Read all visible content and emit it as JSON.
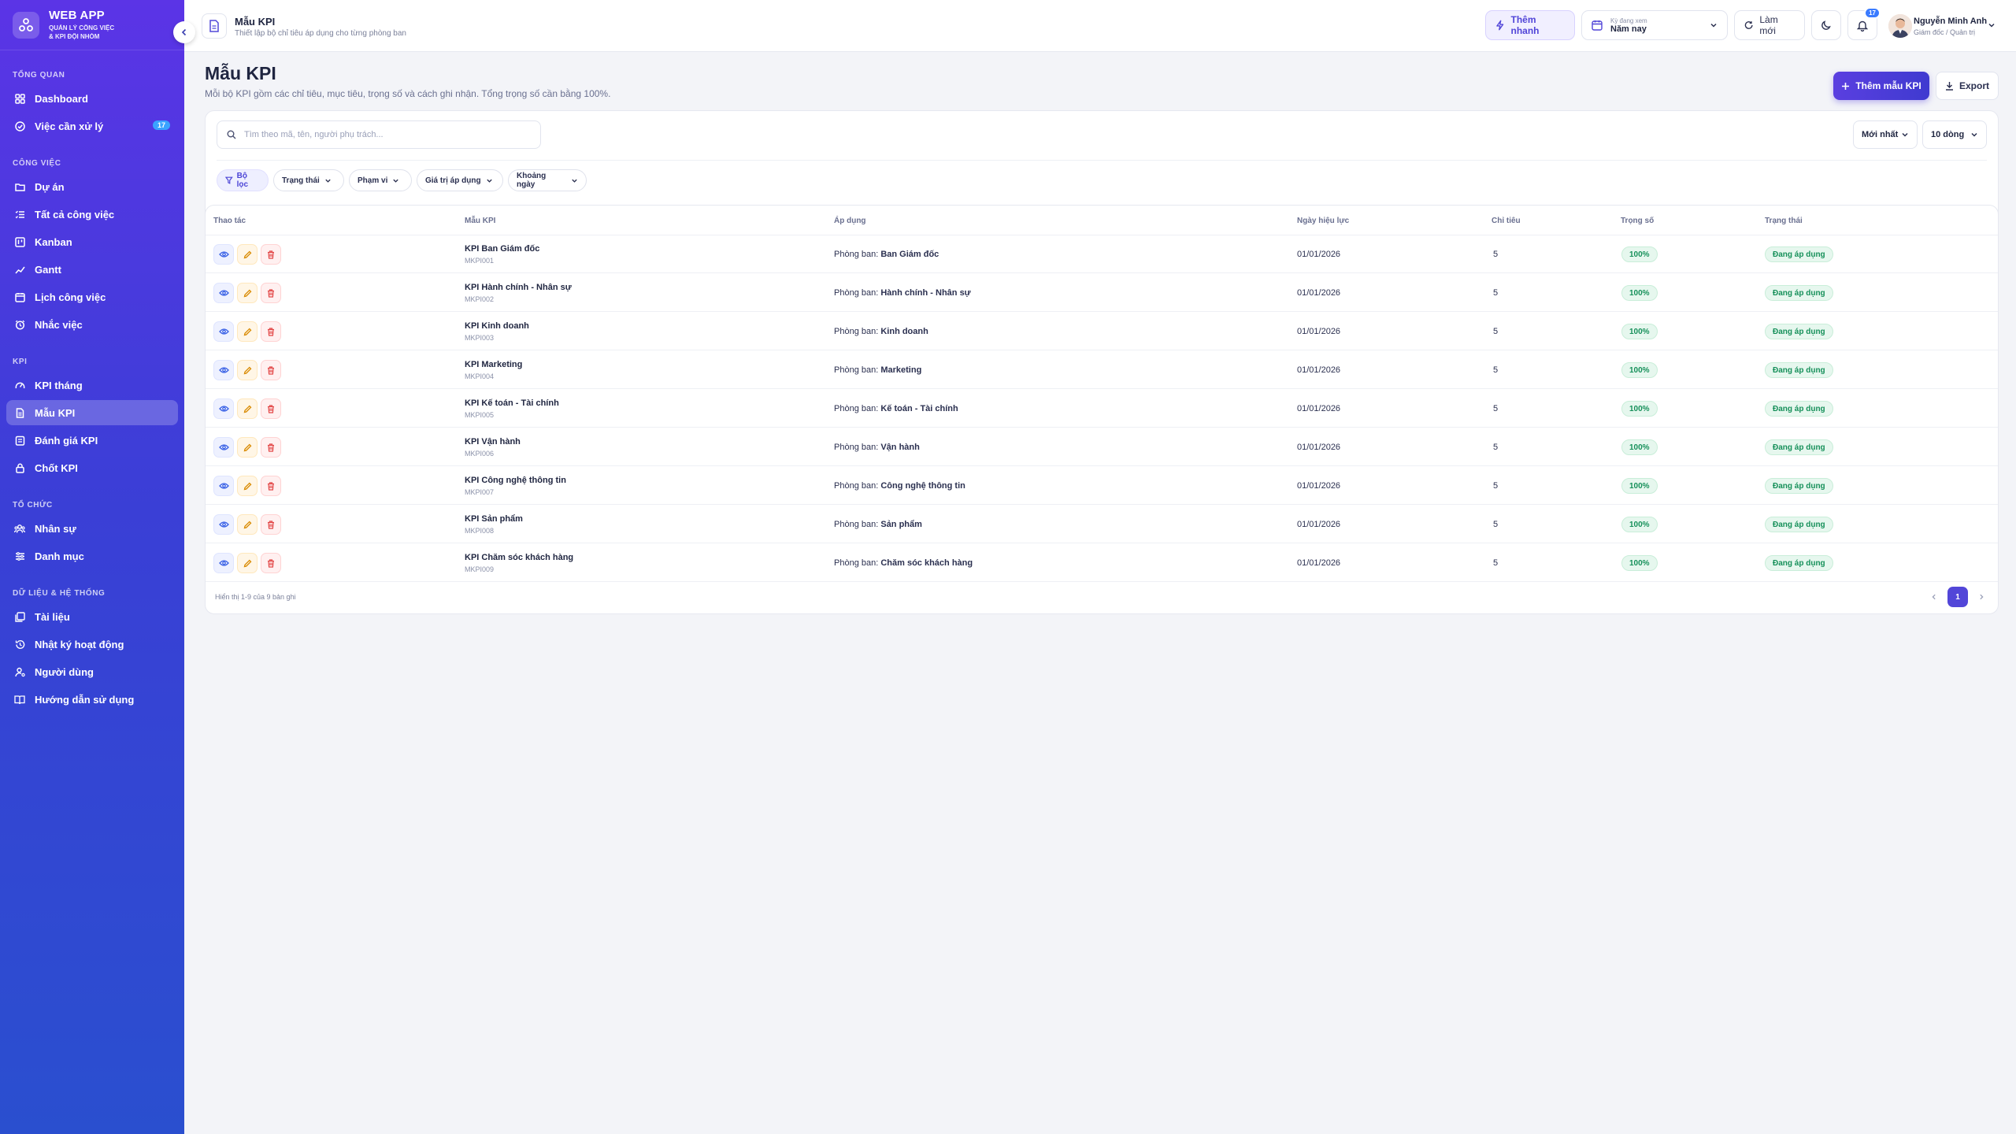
{
  "sidebar": {
    "brand_title": "WEB APP",
    "brand_sub_1": "QUẢN LÝ CÔNG VIỆC",
    "brand_sub_2": "& KPI ĐỘI NHÓM",
    "sections": {
      "overview": "TỔNG QUAN",
      "work": "CÔNG VIỆC",
      "kpi": "KPI",
      "org": "TỔ CHỨC",
      "data": "DỮ LIỆU & HỆ THỐNG"
    },
    "items": {
      "dashboard": "Dashboard",
      "todo": "Việc cần xử lý",
      "todo_count": "17",
      "projects": "Dự án",
      "all_tasks": "Tất cả công việc",
      "kanban": "Kanban",
      "gantt": "Gantt",
      "schedule": "Lịch công việc",
      "reminders": "Nhắc việc",
      "kpi_month": "KPI tháng",
      "kpi_template": "Mẫu KPI",
      "kpi_review": "Đánh giá KPI",
      "kpi_close": "Chốt KPI",
      "staff": "Nhân sự",
      "catalog": "Danh mục",
      "documents": "Tài liệu",
      "activity_log": "Nhật ký hoạt động",
      "users": "Người dùng",
      "guide": "Hướng dẫn sử dụng"
    }
  },
  "topbar": {
    "title": "Mẫu KPI",
    "subtitle": "Thiết lập bộ chỉ tiêu áp dụng cho từng phòng ban",
    "quick_add": "Thêm nhanh",
    "period_label": "Kỳ đang xem",
    "period_value": "Năm nay",
    "refresh": "Làm mới",
    "notifications_count": "17",
    "user_name": "Nguyễn Minh Anh",
    "user_role": "Giám đốc / Quản trị"
  },
  "page": {
    "title": "Mẫu KPI",
    "description": "Mỗi bộ KPI gồm các chỉ tiêu, mục tiêu, trọng số và cách ghi nhận. Tổng trọng số cần bằng 100%.",
    "add_button": "Thêm mẫu KPI",
    "export_button": "Export"
  },
  "filters": {
    "search_placeholder": "Tìm theo mã, tên, người phụ trách...",
    "sort_value": "Mới nhất",
    "rows_value": "10 dòng",
    "chips": {
      "filter": "Bộ lọc",
      "status": "Trạng thái",
      "scope": "Phạm vi",
      "value": "Giá trị áp dụng",
      "date_range": "Khoảng ngày"
    }
  },
  "table": {
    "headers": {
      "actions": "Thao tác",
      "template": "Mẫu KPI",
      "apply": "Áp dụng",
      "effective_date": "Ngày hiệu lực",
      "targets": "Chỉ tiêu",
      "weight": "Trọng số",
      "status": "Trạng thái"
    },
    "apply_prefix": "Phòng ban: ",
    "rows": [
      {
        "name": "KPI Ban Giám đốc",
        "code": "MKPI001",
        "dept": "Ban Giám đốc",
        "date": "01/01/2026",
        "targets": "5",
        "weight": "100%",
        "status": "Đang áp dụng"
      },
      {
        "name": "KPI Hành chính - Nhân sự",
        "code": "MKPI002",
        "dept": "Hành chính - Nhân sự",
        "date": "01/01/2026",
        "targets": "5",
        "weight": "100%",
        "status": "Đang áp dụng"
      },
      {
        "name": "KPI Kinh doanh",
        "code": "MKPI003",
        "dept": "Kinh doanh",
        "date": "01/01/2026",
        "targets": "5",
        "weight": "100%",
        "status": "Đang áp dụng"
      },
      {
        "name": "KPI Marketing",
        "code": "MKPI004",
        "dept": "Marketing",
        "date": "01/01/2026",
        "targets": "5",
        "weight": "100%",
        "status": "Đang áp dụng"
      },
      {
        "name": "KPI Kế toán - Tài chính",
        "code": "MKPI005",
        "dept": "Kế toán - Tài chính",
        "date": "01/01/2026",
        "targets": "5",
        "weight": "100%",
        "status": "Đang áp dụng"
      },
      {
        "name": "KPI Vận hành",
        "code": "MKPI006",
        "dept": "Vận hành",
        "date": "01/01/2026",
        "targets": "5",
        "weight": "100%",
        "status": "Đang áp dụng"
      },
      {
        "name": "KPI Công nghệ thông tin",
        "code": "MKPI007",
        "dept": "Công nghệ thông tin",
        "date": "01/01/2026",
        "targets": "5",
        "weight": "100%",
        "status": "Đang áp dụng"
      },
      {
        "name": "KPI Sản phẩm",
        "code": "MKPI008",
        "dept": "Sản phẩm",
        "date": "01/01/2026",
        "targets": "5",
        "weight": "100%",
        "status": "Đang áp dụng"
      },
      {
        "name": "KPI Chăm sóc khách hàng",
        "code": "MKPI009",
        "dept": "Chăm sóc khách hàng",
        "date": "01/01/2026",
        "targets": "5",
        "weight": "100%",
        "status": "Đang áp dụng"
      }
    ],
    "footer_info": "Hiển thị 1-9 của 9 bản ghi",
    "current_page": "1"
  },
  "colors": {
    "accent": "#5246d8",
    "sidebar_top": "#5b34e6",
    "sidebar_bottom": "#2a4fcf",
    "success": "#16905a"
  }
}
